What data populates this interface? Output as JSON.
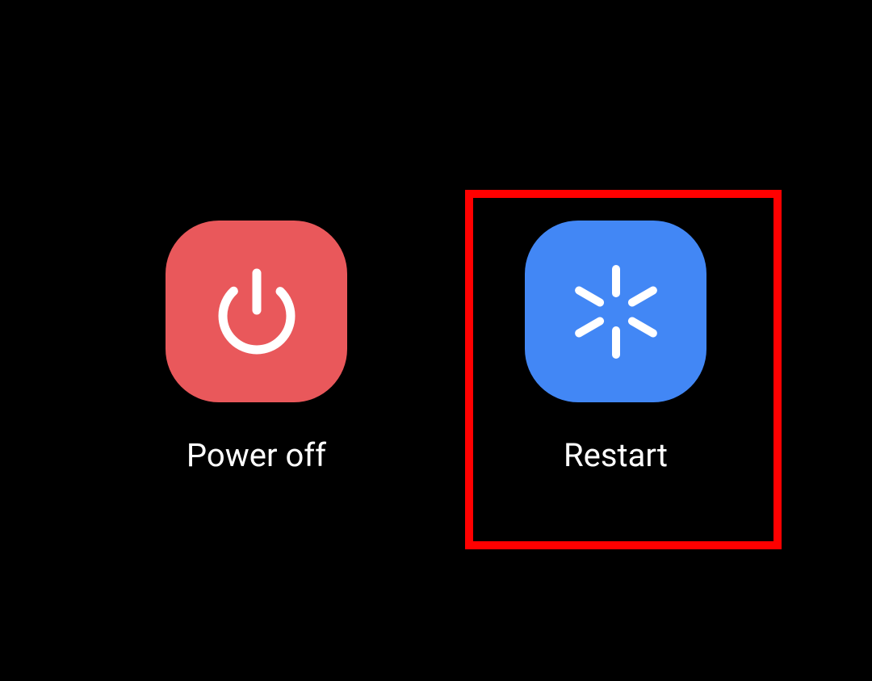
{
  "power_menu": {
    "options": [
      {
        "label": "Power off",
        "icon_name": "power-icon",
        "background_color": "#E9585B"
      },
      {
        "label": "Restart",
        "icon_name": "restart-icon",
        "background_color": "#4287F5"
      }
    ]
  },
  "highlight": {
    "target": "restart",
    "color": "#FF0000"
  }
}
